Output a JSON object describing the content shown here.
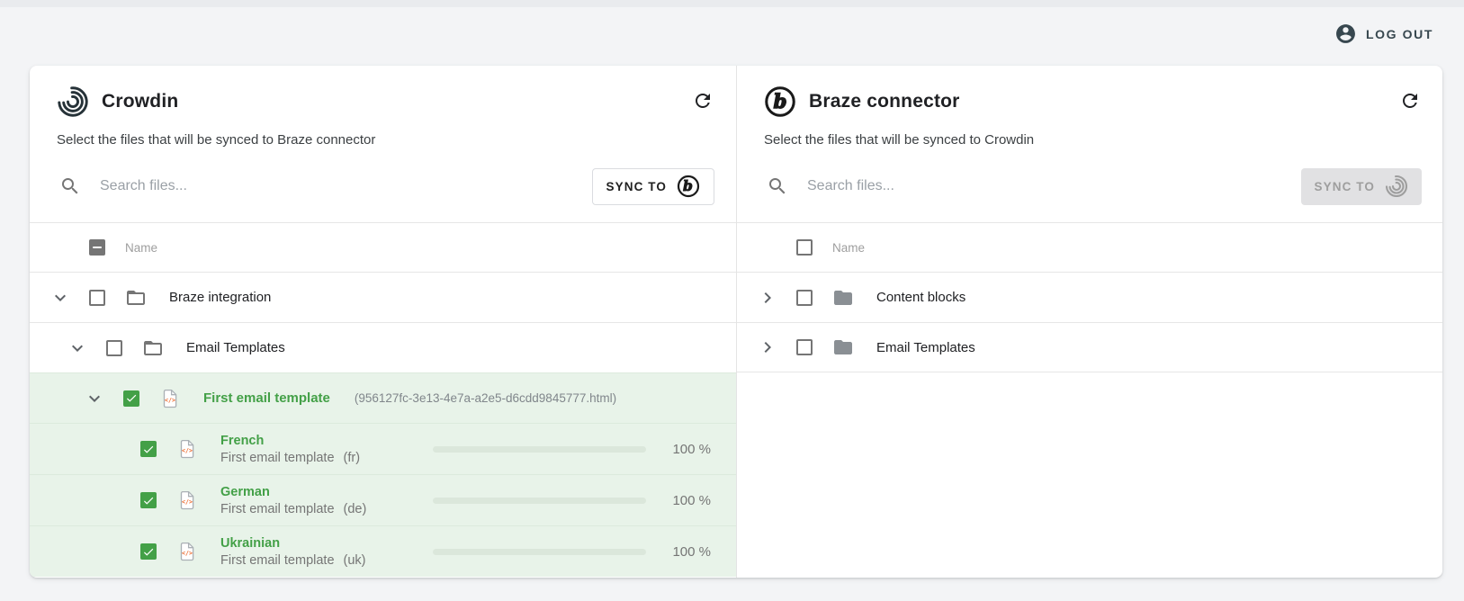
{
  "topbar": {
    "logout_label": "LOG OUT"
  },
  "colors": {
    "accent_green": "#43a047",
    "row_highlight_green": "#e8f3e9",
    "progress_blue": "#6f9ce8",
    "divider_gray": "#e6e6e6"
  },
  "left_panel": {
    "title": "Crowdin",
    "subtitle": "Select the files that will be synced to Braze connector",
    "search_placeholder": "Search files...",
    "search_value": "",
    "sync_button_label": "SYNC TO",
    "sync_button_target_logo": "braze-logo",
    "sync_button_enabled": true,
    "tree_header": "Name",
    "header_checkbox_state": "indeterminate",
    "rows": [
      {
        "type": "folder",
        "level": 0,
        "label": "Braze integration",
        "expanded": true,
        "checked": false
      },
      {
        "type": "folder",
        "level": 1,
        "label": "Email Templates",
        "expanded": true,
        "checked": false
      },
      {
        "type": "file",
        "level": 2,
        "label": "First email template",
        "filename": "(956127fc-3e13-4e7a-a2e5-d6cdd9845777.html)",
        "expanded": true,
        "checked": true,
        "highlighted": true
      },
      {
        "type": "language",
        "level": 3,
        "language": "French",
        "template": "First email template",
        "code": "(fr)",
        "checked": true,
        "highlighted": true,
        "progress": 100,
        "progress_label": "100 %"
      },
      {
        "type": "language",
        "level": 3,
        "language": "German",
        "template": "First email template",
        "code": "(de)",
        "checked": true,
        "highlighted": true,
        "progress": 100,
        "progress_label": "100 %"
      },
      {
        "type": "language",
        "level": 3,
        "language": "Ukrainian",
        "template": "First email template",
        "code": "(uk)",
        "checked": true,
        "highlighted": true,
        "progress": 100,
        "progress_label": "100 %"
      }
    ]
  },
  "right_panel": {
    "title": "Braze connector",
    "subtitle": "Select the files that will be synced to Crowdin",
    "search_placeholder": "Search files...",
    "search_value": "",
    "sync_button_label": "SYNC TO",
    "sync_button_target_logo": "crowdin-logo",
    "sync_button_enabled": false,
    "tree_header": "Name",
    "header_checkbox_state": "unchecked",
    "rows": [
      {
        "type": "folder",
        "level": 0,
        "label": "Content blocks",
        "expanded": false,
        "checked": false
      },
      {
        "type": "folder",
        "level": 0,
        "label": "Email Templates",
        "expanded": false,
        "checked": false
      }
    ]
  }
}
